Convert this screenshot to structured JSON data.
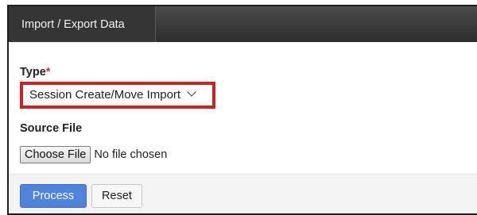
{
  "tab": {
    "label": "Import / Export Data"
  },
  "form": {
    "type_label": "Type",
    "required_marker": "*",
    "type_value": "Session Create/Move Import",
    "source_label": "Source File",
    "choose_file_label": "Choose File",
    "file_status": "No file chosen"
  },
  "buttons": {
    "process": "Process",
    "reset": "Reset"
  },
  "colors": {
    "highlight": "#d12020",
    "primary": "#4f83dc",
    "required": "#d32f2f",
    "tabbar": "#353535"
  }
}
